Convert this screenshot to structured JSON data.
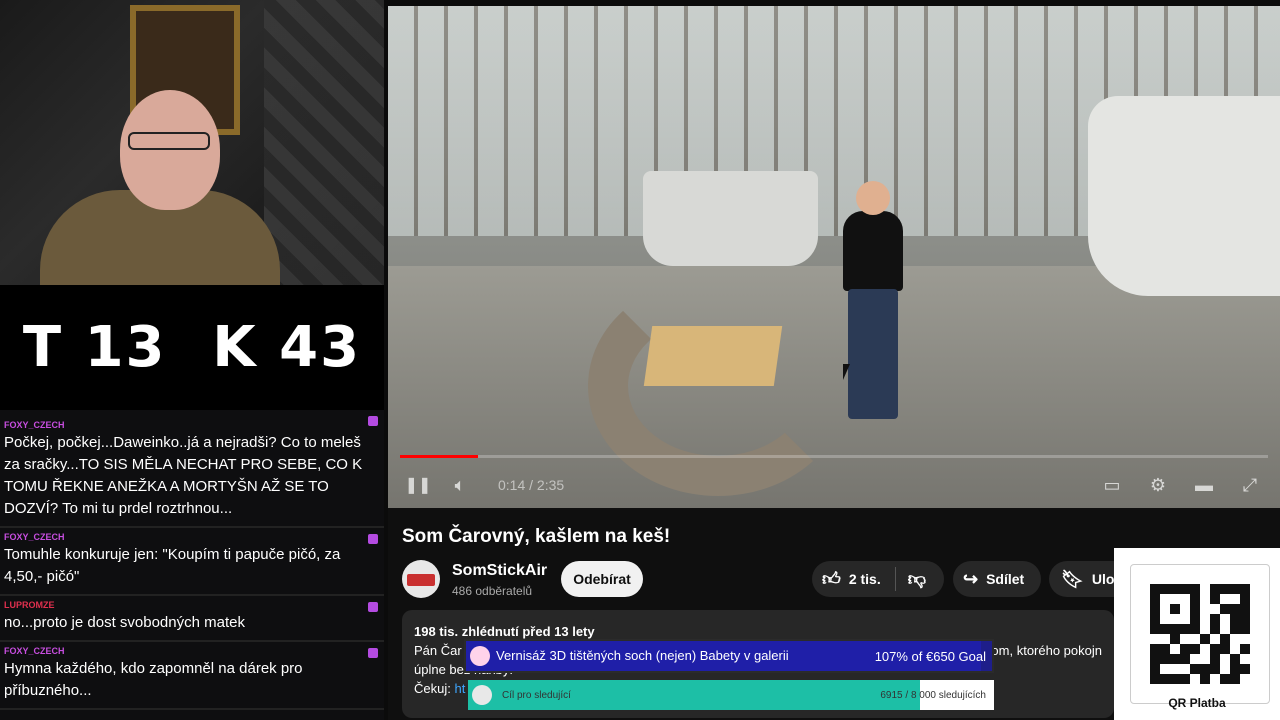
{
  "score": {
    "left": "T 13",
    "right": "K 43"
  },
  "chat": [
    {
      "user": "FOXY_CZECH",
      "color": "#c84ee0",
      "text": "Počkej, počkej...Daweinko..já a nejradši? Co to meleš za sračky...TO SIS MĚLA NECHAT PRO SEBE, CO K TOMU ŘEKNE ANEŽKA A MORTYŠN AŽ SE TO DOZVÍ? To mi tu prdel roztrhnou..."
    },
    {
      "user": "FOXY_CZECH",
      "color": "#c84ee0",
      "text": "Tomuhle konkuruje jen: \"Koupím ti papuče pičó, za 4,50,- pičó\""
    },
    {
      "user": "LUPROMZE",
      "color": "#e0304e",
      "text": "no...proto je dost svobodných matek"
    },
    {
      "user": "FOXY_CZECH",
      "color": "#c84ee0",
      "text": "Hymna každého, kdo zapomněl na dárek pro příbuzného..."
    }
  ],
  "video": {
    "time": "0:14 / 2:35",
    "progress": 0.09,
    "icons": {
      "play": "pause-icon",
      "volume": "volume-icon",
      "subtitles": "subtitles-icon",
      "settings": "settings-icon",
      "theater": "theater-icon",
      "fullscreen": "fullscreen-icon"
    },
    "title": "Som Čarovný, kašlem na keš!",
    "channel": "SomStickAir",
    "subs": "486 odběratelů",
    "subscribe": "Odebírat",
    "likes": "2 tis.",
    "share": "Sdílet",
    "save": "Ulož"
  },
  "description": {
    "meta": "198 tis. zhlédnutí  před 13 lety",
    "line1": "Pán Čar",
    "line1_tail": "rom, ktorého pokojn",
    "line2": "úplne bez hanby!",
    "line3_prefix": "Čekuj: ",
    "line3_link": "ht"
  },
  "goals": {
    "goal1_text": "Vernisáž 3D tištěných soch (nejen) Babety v galerii",
    "goal1_amount": "107% of €650 Goal",
    "goal2_text": "Cíl pro sledující",
    "goal2_amount": "6915 / 8 000 sledujících",
    "goal2_progress": 0.86
  },
  "qr": {
    "label": "QR Platba"
  }
}
